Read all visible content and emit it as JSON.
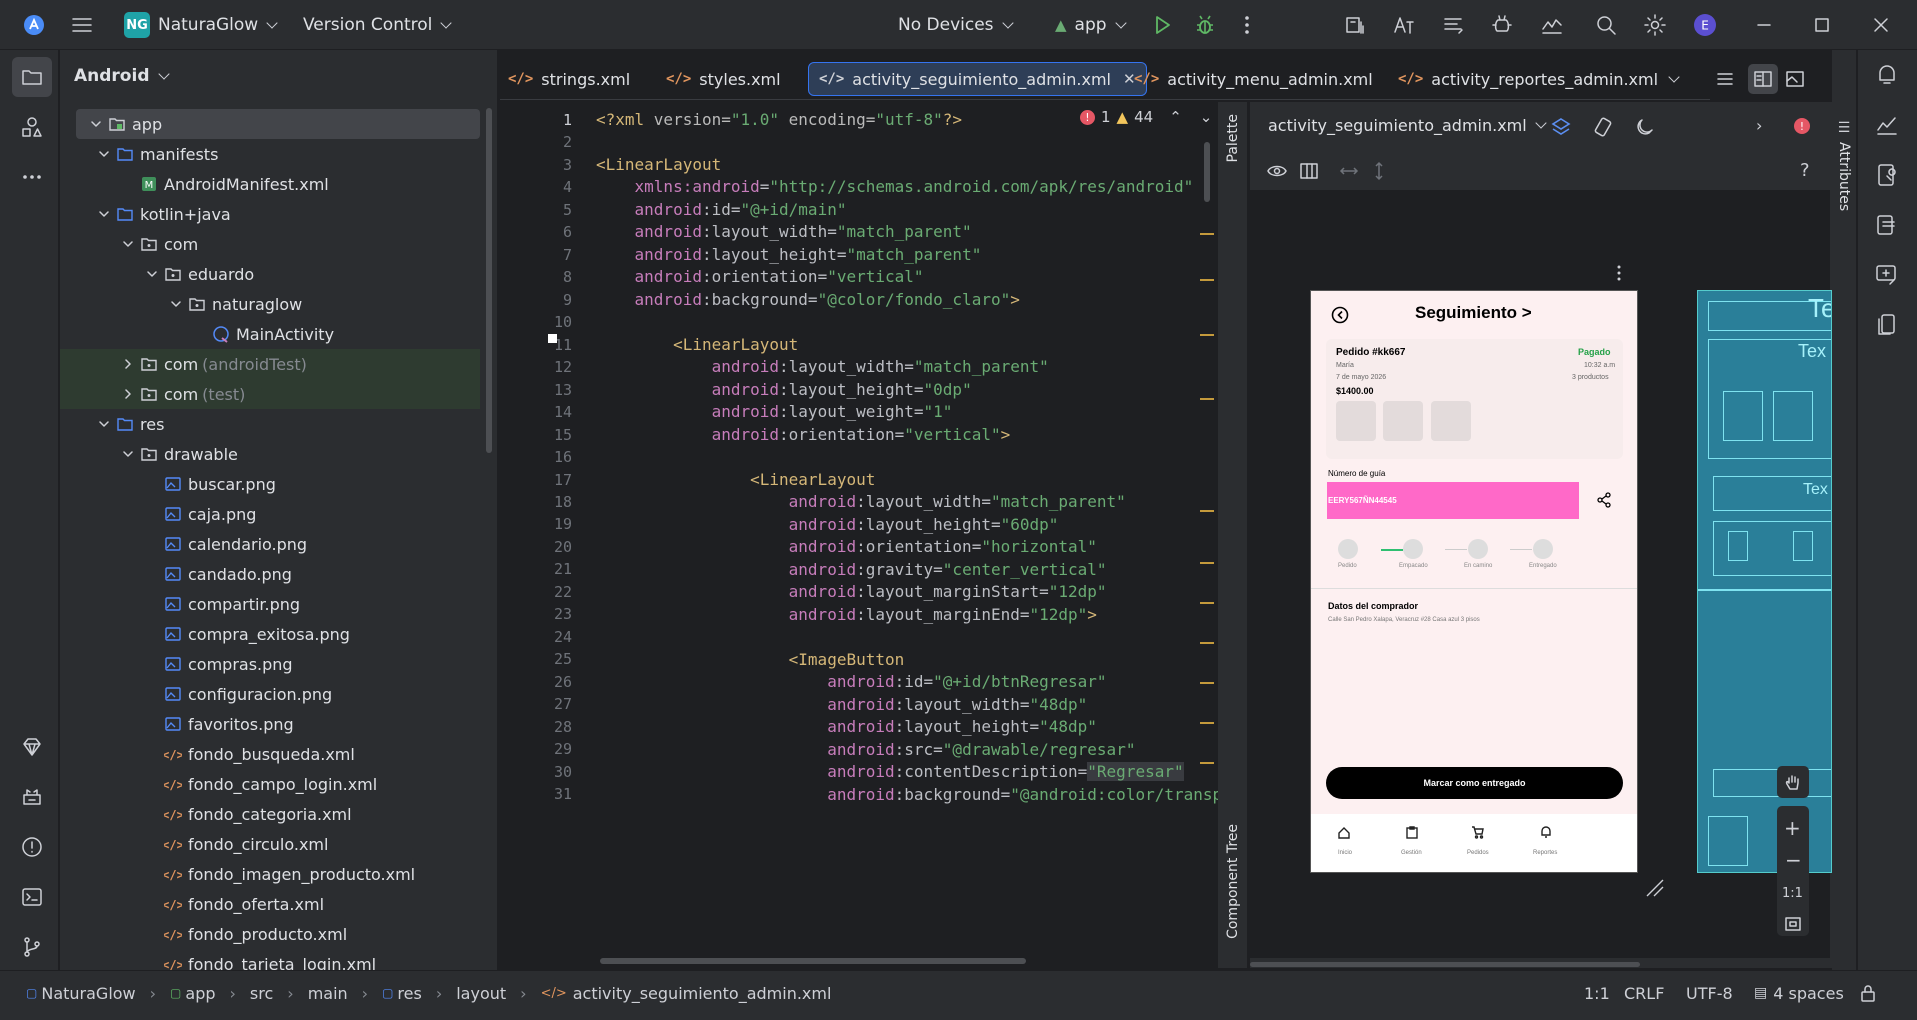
{
  "topbar": {
    "project_badge": "NG",
    "project_name": "NaturaGlow",
    "vcs": "Version Control",
    "devices": "No Devices",
    "run_config": "app"
  },
  "project_panel": {
    "title": "Android",
    "tree": [
      {
        "label": "app",
        "dim": ""
      },
      {
        "label": "manifests",
        "dim": ""
      },
      {
        "label": "AndroidManifest.xml",
        "dim": ""
      },
      {
        "label": "kotlin+java",
        "dim": ""
      },
      {
        "label": "com",
        "dim": ""
      },
      {
        "label": "eduardo",
        "dim": ""
      },
      {
        "label": "naturaglow",
        "dim": ""
      },
      {
        "label": "MainActivity",
        "dim": ""
      },
      {
        "label": "com",
        "dim": "(androidTest)"
      },
      {
        "label": "com",
        "dim": "(test)"
      },
      {
        "label": "res",
        "dim": ""
      },
      {
        "label": "drawable",
        "dim": ""
      },
      {
        "label": "buscar.png",
        "dim": ""
      },
      {
        "label": "caja.png",
        "dim": ""
      },
      {
        "label": "calendario.png",
        "dim": ""
      },
      {
        "label": "candado.png",
        "dim": ""
      },
      {
        "label": "compartir.png",
        "dim": ""
      },
      {
        "label": "compra_exitosa.png",
        "dim": ""
      },
      {
        "label": "compras.png",
        "dim": ""
      },
      {
        "label": "configuracion.png",
        "dim": ""
      },
      {
        "label": "favoritos.png",
        "dim": ""
      },
      {
        "label": "fondo_busqueda.xml",
        "dim": ""
      },
      {
        "label": "fondo_campo_login.xml",
        "dim": ""
      },
      {
        "label": "fondo_categoria.xml",
        "dim": ""
      },
      {
        "label": "fondo_circulo.xml",
        "dim": ""
      },
      {
        "label": "fondo_imagen_producto.xml",
        "dim": ""
      },
      {
        "label": "fondo_oferta.xml",
        "dim": ""
      },
      {
        "label": "fondo_producto.xml",
        "dim": ""
      },
      {
        "label": "fondo_tarjeta_login.xml",
        "dim": ""
      }
    ]
  },
  "tabs": [
    {
      "label": "strings.xml"
    },
    {
      "label": "styles.xml"
    },
    {
      "label": "activity_seguimiento_admin.xml"
    },
    {
      "label": "activity_menu_admin.xml"
    },
    {
      "label": "activity_reportes_admin.xml"
    }
  ],
  "editor": {
    "errors": "1",
    "warnings": "44",
    "line_numbers": [
      "1",
      "2",
      "3",
      "4",
      "5",
      "6",
      "7",
      "8",
      "9",
      "10",
      "11",
      "12",
      "13",
      "14",
      "15",
      "16",
      "17",
      "18",
      "19",
      "20",
      "21",
      "22",
      "23",
      "24",
      "25",
      "26",
      "27",
      "28",
      "29",
      "30",
      "31"
    ]
  },
  "design": {
    "file_selector": "activity_seguimiento_admin.xml",
    "palette_label": "Palette",
    "component_tree_label": "Component Tree",
    "attributes_label": "Attributes",
    "zoom_reset": "1:1",
    "phone": {
      "title": "Seguimiento >",
      "order_id": "Pedido #kk667",
      "status": "Pagado",
      "customer": "María",
      "time": "10:32 a.m",
      "date": "7 de mayo 2026",
      "products": "3 productos",
      "total": "$1400.00",
      "guide_label": "Número de guía",
      "guide_value": "EERY567ÑN44545",
      "steps": [
        "Pedido",
        "Empacado",
        "En camino",
        "Entregado"
      ],
      "buyer_title": "Datos del comprador",
      "buyer_address": "Calle San Pedro Xalapa, Veracruz #28 Casa azul 3 pisos",
      "cta": "Marcar como entregado",
      "nav": [
        "Inicio",
        "Gestión",
        "Pedidos",
        "Reportes"
      ]
    },
    "blueprint_labels": [
      "Te",
      "Tex",
      "Tex"
    ]
  },
  "statusbar": {
    "breadcrumbs": [
      "NaturaGlow",
      "app",
      "src",
      "main",
      "res",
      "layout",
      "activity_seguimiento_admin.xml"
    ],
    "position": "1:1",
    "line_sep": "CRLF",
    "encoding": "UTF-8",
    "indent": "4 spaces"
  },
  "colors": {
    "accent": "#3574f0",
    "guide_box": "#ff69c8",
    "status_green": "#24a148",
    "error": "#e55765",
    "warning": "#f2c55c"
  }
}
